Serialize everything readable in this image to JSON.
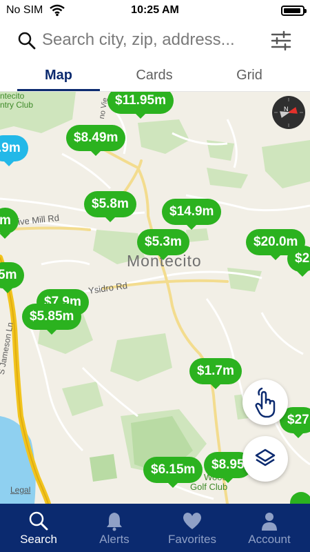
{
  "status_bar": {
    "carrier": "No SIM",
    "time": "10:25 AM"
  },
  "search": {
    "placeholder": "Search city, zip, address..."
  },
  "tabs": [
    {
      "label": "Map",
      "active": true
    },
    {
      "label": "Cards",
      "active": false
    },
    {
      "label": "Grid",
      "active": false
    }
  ],
  "map": {
    "town": "Montecito",
    "labels": {
      "club": "ntecito\nntry Club",
      "road_1": "ive Mill Rd",
      "road_2": "Ysidro Rd",
      "road_3": "S Jameson Ln",
      "road_4": "no Vie",
      "golf": "Golf Club",
      "golf2": "Wood",
      "legal": "Legal"
    },
    "pins": [
      {
        "label": "$11.95m",
        "color": "green"
      },
      {
        "label": ".9m",
        "color": "blue"
      },
      {
        "label": "$8.49m",
        "color": "green"
      },
      {
        "label": "$5.8m",
        "color": "green"
      },
      {
        "label": "$14.9m",
        "color": "green"
      },
      {
        "label": "m",
        "color": "green"
      },
      {
        "label": "$5.3m",
        "color": "green"
      },
      {
        "label": "$20.0m",
        "color": "green"
      },
      {
        "label": "$2",
        "color": "green"
      },
      {
        "label": "5m",
        "color": "green"
      },
      {
        "label": "$7.9m",
        "color": "green"
      },
      {
        "label": "$5.85m",
        "color": "green"
      },
      {
        "label": "$1.7m",
        "color": "green"
      },
      {
        "label": "$27",
        "color": "green"
      },
      {
        "label": "$6.15m",
        "color": "green"
      },
      {
        "label": "$8.95",
        "color": "green"
      }
    ]
  },
  "bottom_nav": [
    {
      "label": "Search",
      "icon": "search-icon",
      "active": true
    },
    {
      "label": "Alerts",
      "icon": "bell-icon",
      "active": false
    },
    {
      "label": "Favorites",
      "icon": "heart-icon",
      "active": false
    },
    {
      "label": "Account",
      "icon": "person-icon",
      "active": false
    }
  ],
  "colors": {
    "primary": "#0b2a6f",
    "pin_green": "#2bb21f",
    "pin_blue": "#23b8e8"
  }
}
